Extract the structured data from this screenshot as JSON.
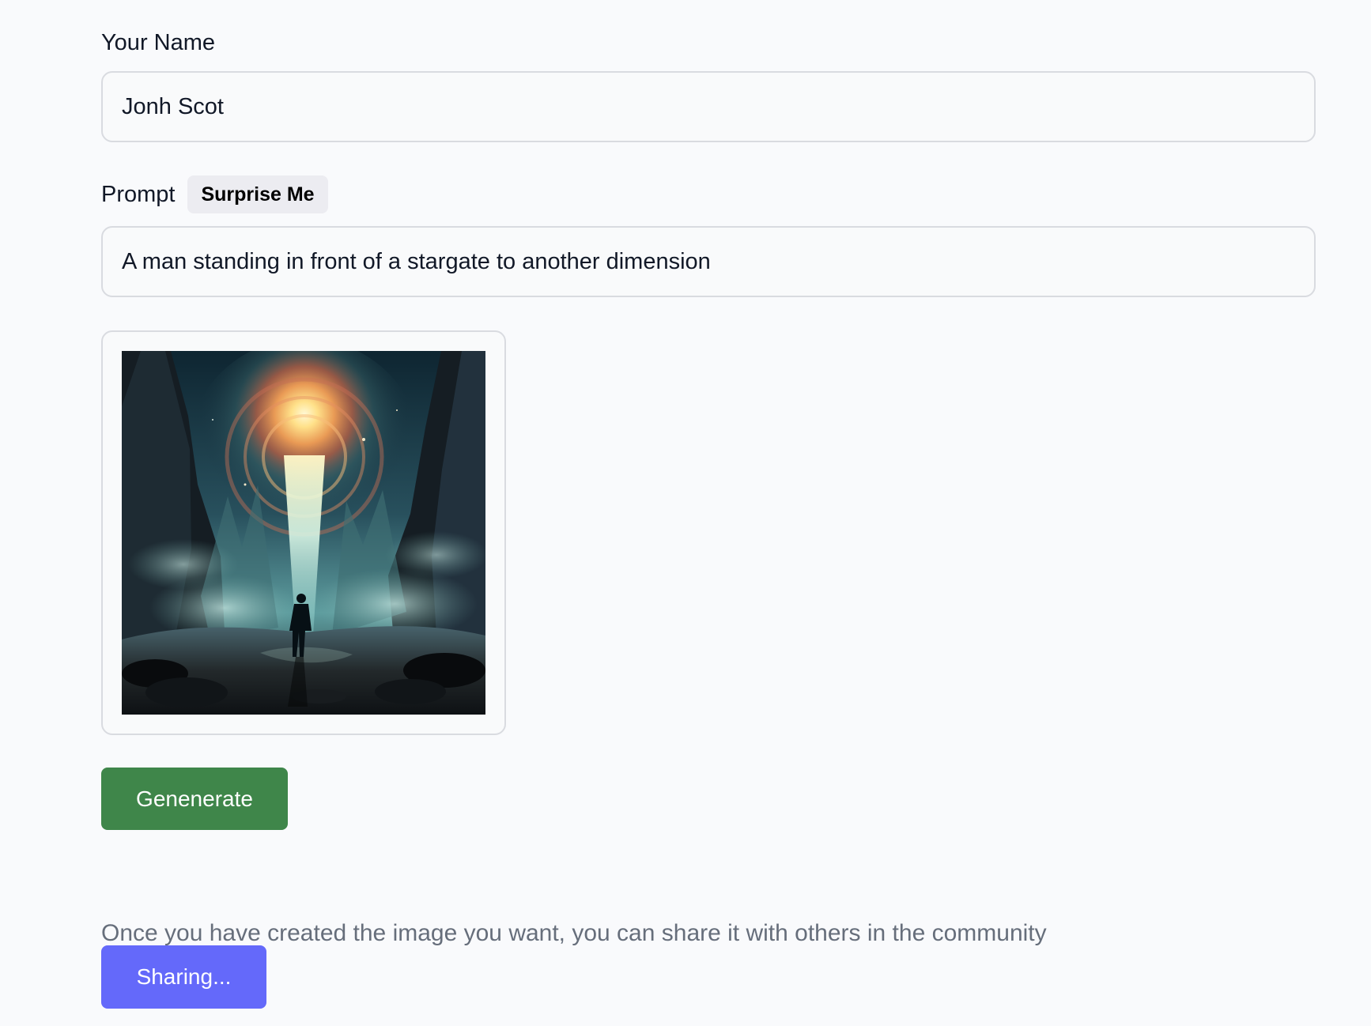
{
  "form": {
    "name_label": "Your Name",
    "name_value": "Jonh Scot",
    "prompt_label": "Prompt",
    "surprise_label": "Surprise Me",
    "prompt_value": "A man standing in front of a stargate to another dimension",
    "generate_label": "Genenerate",
    "share_note": "Once you have created the image you want, you can share it with others in the community",
    "share_label": "Sharing..."
  },
  "image": {
    "name": "stargate-man-image"
  },
  "colors": {
    "page_background": "#f9fafc",
    "input_border": "#d9dbe0",
    "generate_button": "#3f864a",
    "share_button": "#6469fa",
    "surprise_button": "#ececf1",
    "muted_text": "#666e7b"
  }
}
